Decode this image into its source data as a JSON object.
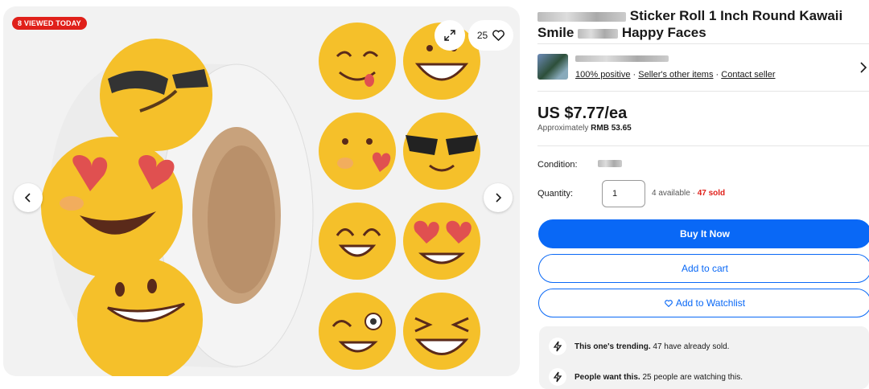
{
  "gallery": {
    "badge": "8 VIEWED TODAY",
    "watch_count": "25",
    "icons": {
      "expand": "expand-icon",
      "heart": "heart-icon",
      "prev": "chevron-left-icon",
      "next": "chevron-right-icon"
    }
  },
  "listing": {
    "title_text": "Sticker Roll 1 Inch Round Kawaii",
    "title_text2": "Smile",
    "title_text3": "Happy Faces"
  },
  "seller": {
    "positive": "100% positive",
    "sep1": " · ",
    "other_items": "Seller's other items",
    "sep2": " · ",
    "contact": "Contact seller"
  },
  "pricing": {
    "price": "US $7.77/ea",
    "approx_label": "Approximately ",
    "approx_value": "RMB 53.65"
  },
  "purchase": {
    "condition_label": "Condition:",
    "quantity_label": "Quantity:",
    "quantity_value": "1",
    "available": "4 available · ",
    "sold": "47 sold",
    "buy_now": "Buy It Now",
    "add_to_cart": "Add to cart",
    "watchlist": "Add to Watchlist"
  },
  "promos": [
    {
      "bold": "This one's trending.",
      "text": " 47 have already sold."
    },
    {
      "bold": "People want this.",
      "text": " 25 people are watching this."
    }
  ],
  "colors": {
    "accent": "#0968f6",
    "badge": "#e0201a",
    "sticker": "#f6c22a"
  }
}
